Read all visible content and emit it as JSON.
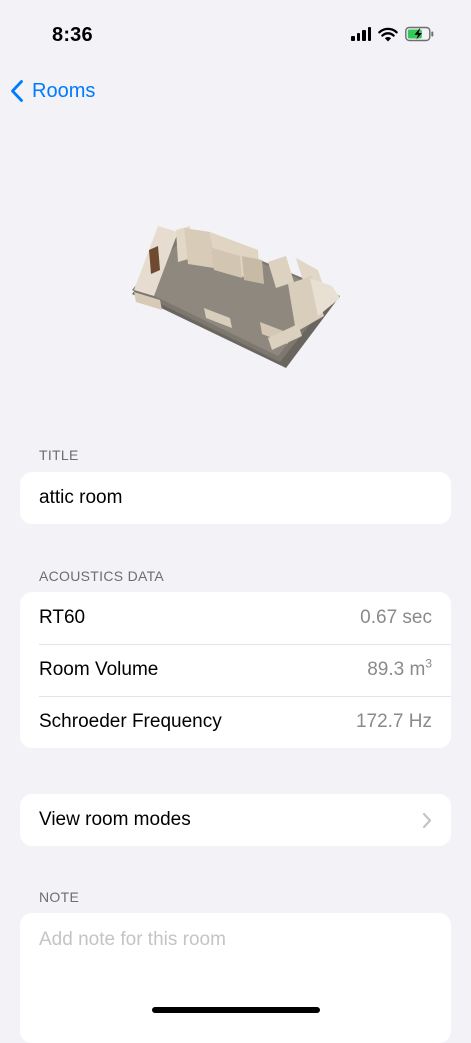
{
  "status_bar": {
    "time": "8:36"
  },
  "nav": {
    "back_label": "Rooms"
  },
  "title_section": {
    "header": "TITLE",
    "value": "attic room"
  },
  "acoustics": {
    "header": "ACOUSTICS DATA",
    "rows": [
      {
        "label": "RT60",
        "value": "0.67 sec"
      },
      {
        "label": "Room Volume",
        "value": "89.3 m",
        "unit_sup": "3"
      },
      {
        "label": "Schroeder Frequency",
        "value": "172.7 Hz"
      }
    ]
  },
  "modes": {
    "label": "View room modes"
  },
  "note": {
    "header": "NOTE",
    "placeholder": "Add note for this room"
  },
  "colors": {
    "accent": "#007aff",
    "background": "#f2f2f7",
    "battery": "#34c759"
  },
  "icons": [
    "signal-icon",
    "wifi-icon",
    "battery-charging-icon",
    "chevron-left-icon",
    "chevron-right-icon",
    "room-3d-model"
  ]
}
